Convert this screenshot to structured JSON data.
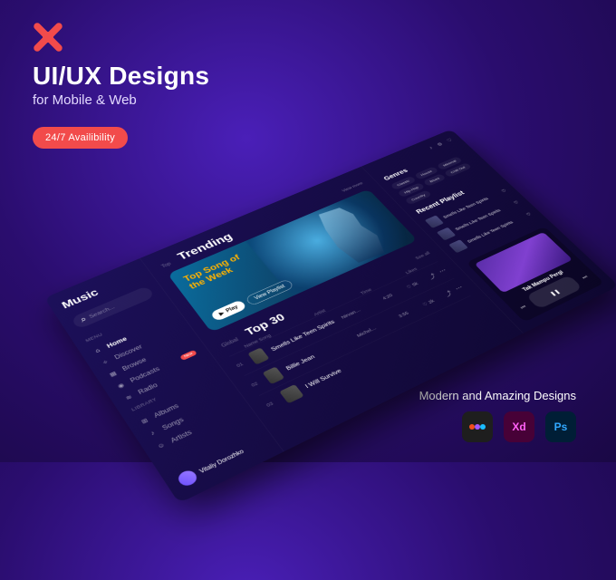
{
  "marketing": {
    "headline": "UI/UX Designs",
    "sub": "for Mobile & Web",
    "badge": "24/7 Availibility",
    "footer": "Modern and Amazing Designs",
    "tools": {
      "xd": "Xd",
      "ps": "Ps"
    }
  },
  "sidebar": {
    "brand": "Music",
    "search_placeholder": "Search...",
    "labels": {
      "menu": "Menu",
      "library": "Library"
    },
    "menu": [
      {
        "label": "Home",
        "icon": "⌂"
      },
      {
        "label": "Discover",
        "icon": "✧"
      },
      {
        "label": "Browse",
        "icon": "▦"
      },
      {
        "label": "Podcasts",
        "icon": "◉",
        "tag": "New"
      },
      {
        "label": "Radio",
        "icon": "≋"
      }
    ],
    "library": [
      {
        "label": "Albums",
        "icon": "⊞"
      },
      {
        "label": "Songs",
        "icon": "♪"
      },
      {
        "label": "Artists",
        "icon": "☺"
      }
    ],
    "user": "Vitaliy Dorozhko"
  },
  "main": {
    "tab_small": "Top",
    "tab_big": "Trending",
    "view_more": "View more",
    "hero": {
      "title": "Top Song of the Week",
      "play": "Play",
      "playlist": "View Playlist"
    },
    "list_small": "Global",
    "list_big": "Top 30",
    "cols": {
      "name": "Name Song",
      "artist": "Artist",
      "time": "Time",
      "likes": "Likes",
      "seeall": "See all"
    },
    "tracks": [
      {
        "num": "01",
        "name": "Smells Like Teen Spirits",
        "artist": "Nirvan…",
        "time": "4:20",
        "likes": "5k"
      },
      {
        "num": "02",
        "name": "Billie Jean",
        "artist": "Michel…",
        "time": "3:55",
        "likes": "2k"
      },
      {
        "num": "03",
        "name": "I Will Survive",
        "artist": "",
        "time": "",
        "likes": ""
      }
    ]
  },
  "rail": {
    "genres_title": "Genres",
    "genres": [
      "Classic",
      "House",
      "Minimal",
      "Hip-Hop",
      "Blues",
      "Chill Out",
      "Country"
    ],
    "recent_title": "Recent Playlist",
    "recent": [
      {
        "name": "Smells Like Teen Spirits"
      },
      {
        "name": "Smells Like Teen Spirits"
      },
      {
        "name": "Smells Like Teen Spirits"
      }
    ],
    "now_playing": {
      "title": "Tak Mampu Pergi",
      "artist": ""
    }
  }
}
